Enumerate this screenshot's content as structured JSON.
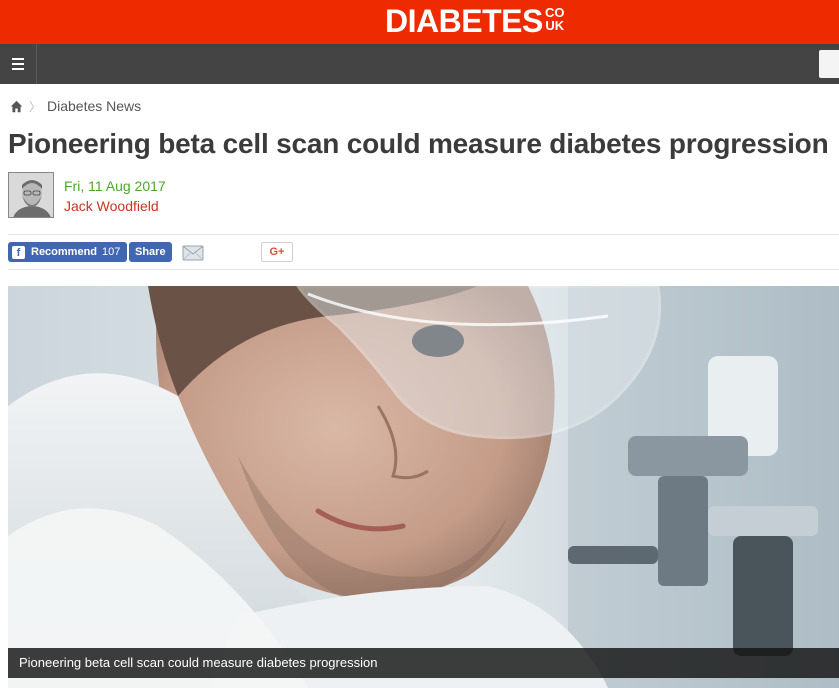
{
  "brand": {
    "logo_text": "DIABETES",
    "logo_suffix_top": "CO",
    "logo_suffix_bottom": "UK",
    "accent_color": "#ee2a00"
  },
  "nav": {
    "menu_icon": "hamburger-icon"
  },
  "breadcrumb": {
    "home_icon": "home-icon",
    "section": "Diabetes News"
  },
  "article": {
    "title": "Pioneering beta cell scan could measure diabetes progression",
    "date": "Fri, 11 Aug 2017",
    "author": "Jack Woodfield",
    "image_caption": "Pioneering beta cell scan could measure diabetes progression"
  },
  "share": {
    "fb_icon_glyph": "f",
    "recommend_label": "Recommend",
    "recommend_count": "107",
    "share_label": "Share",
    "email_icon": "email-icon",
    "gplus_label": "G+"
  }
}
